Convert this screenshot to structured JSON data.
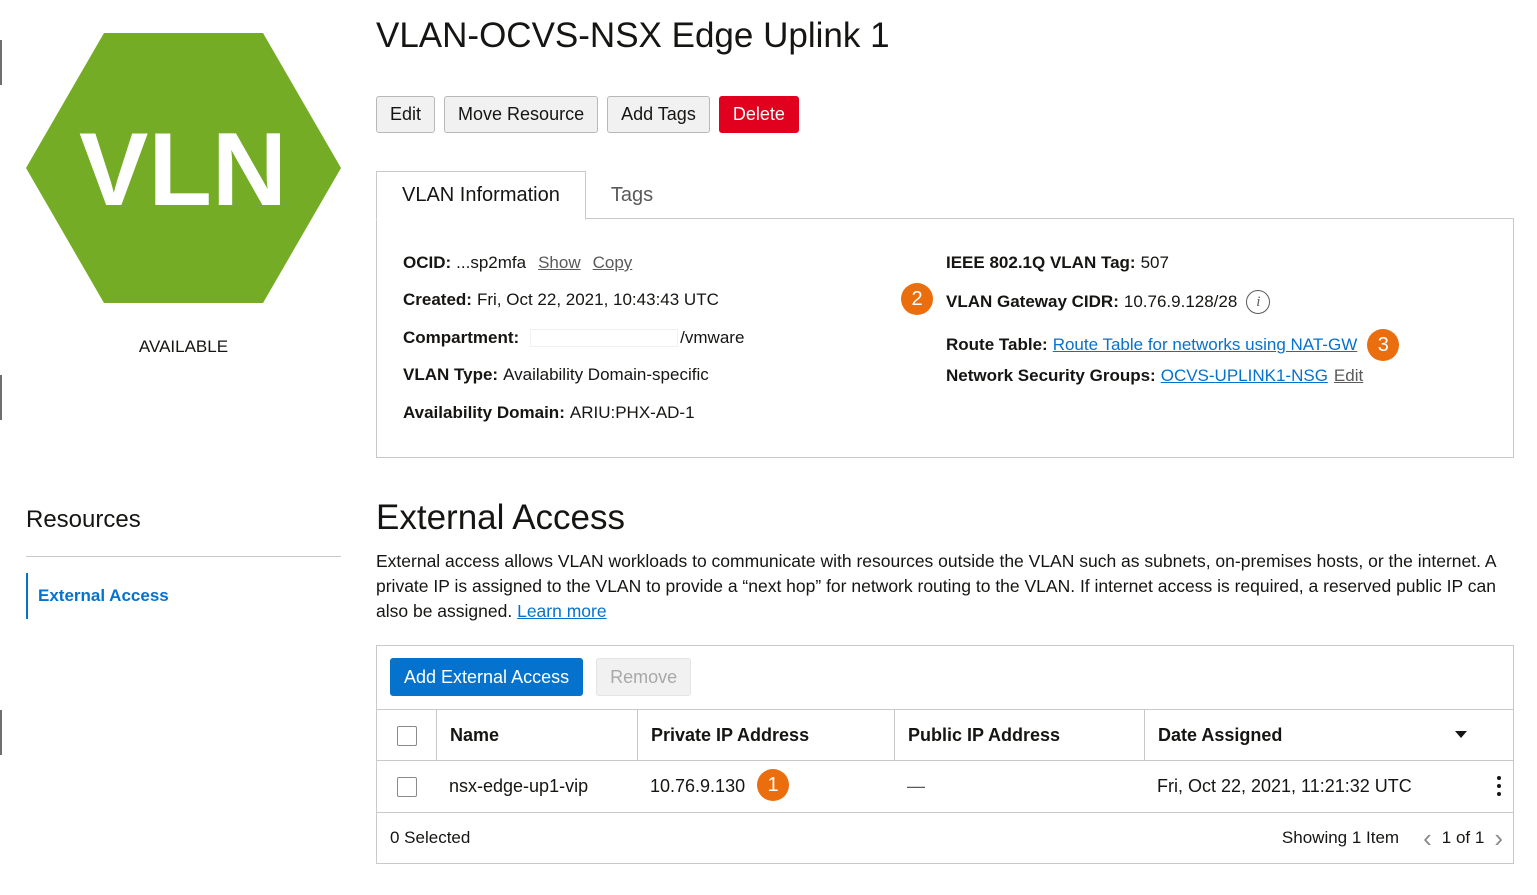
{
  "resource": {
    "icon_text": "VLN",
    "icon_color": "#74ac25",
    "status": "AVAILABLE"
  },
  "header": {
    "title": "VLAN-OCVS-NSX Edge Uplink 1"
  },
  "actions": {
    "edit": "Edit",
    "move": "Move Resource",
    "add_tags": "Add Tags",
    "delete": "Delete"
  },
  "tabs": {
    "info": "VLAN Information",
    "tags": "Tags"
  },
  "info": {
    "ocid_label": "OCID:",
    "ocid_value": "...sp2mfa",
    "ocid_show": "Show",
    "ocid_copy": "Copy",
    "created_label": "Created:",
    "created_value": "Fri, Oct 22, 2021, 10:43:43 UTC",
    "compartment_label": "Compartment:",
    "compartment_value": "/vmware",
    "vlan_type_label": "VLAN Type:",
    "vlan_type_value": "Availability Domain-specific",
    "ad_label": "Availability Domain:",
    "ad_value": "ARIU:PHX-AD-1",
    "vlan_tag_label": "IEEE 802.1Q VLAN Tag:",
    "vlan_tag_value": "507",
    "gateway_label": "VLAN Gateway CIDR:",
    "gateway_value": "10.76.9.128/28",
    "route_label": "Route Table:",
    "route_value": "Route Table for networks using NAT-GW",
    "nsg_label": "Network Security Groups:",
    "nsg_value": "OCVS-UPLINK1-NSG",
    "nsg_edit": "Edit"
  },
  "callouts": {
    "one": "1",
    "two": "2",
    "three": "3",
    "color": "#ea6d0e"
  },
  "sidebar": {
    "title": "Resources",
    "items": [
      "External Access"
    ]
  },
  "external_access": {
    "title": "External Access",
    "description": "External access allows VLAN workloads to communicate with resources outside the VLAN such as subnets, on-premises hosts, or the internet. A private IP is assigned to the VLAN to provide a “next hop” for network routing to the VLAN. If internet access is required, a reserved public IP can also be assigned.",
    "learn_more": "Learn more",
    "add_button": "Add External Access",
    "remove_button": "Remove",
    "columns": [
      "Name",
      "Private IP Address",
      "Public IP Address",
      "Date Assigned"
    ],
    "rows": [
      {
        "name": "nsx-edge-up1-vip",
        "private_ip": "10.76.9.130",
        "public_ip": "—",
        "date": "Fri, Oct 22, 2021, 11:21:32 UTC"
      }
    ],
    "selected": "0 Selected",
    "showing": "Showing 1 Item",
    "page": "1 of 1"
  }
}
